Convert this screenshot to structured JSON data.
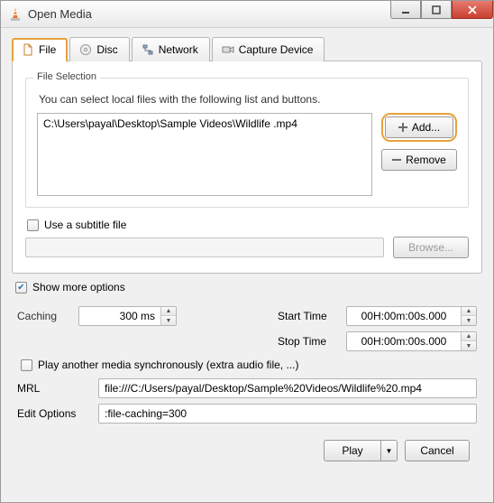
{
  "window": {
    "title": "Open Media"
  },
  "tabs": {
    "file": "File",
    "disc": "Disc",
    "network": "Network",
    "capture": "Capture Device"
  },
  "file_selection": {
    "group_title": "File Selection",
    "help": "You can select local files with the following list and buttons.",
    "files": [
      "C:\\Users\\payal\\Desktop\\Sample Videos\\Wildlife .mp4"
    ],
    "add_label": "Add...",
    "remove_label": "Remove"
  },
  "subtitle": {
    "checkbox_label": "Use a subtitle file",
    "browse_label": "Browse..."
  },
  "show_more": {
    "label": "Show more options",
    "checked": true
  },
  "options": {
    "caching_label": "Caching",
    "caching_value": "300 ms",
    "start_label": "Start Time",
    "start_value": "00H:00m:00s.000",
    "stop_label": "Stop Time",
    "stop_value": "00H:00m:00s.000",
    "synch_label": "Play another media synchronously (extra audio file, ...)",
    "mrl_label": "MRL",
    "mrl_value": "file:///C:/Users/payal/Desktop/Sample%20Videos/Wildlife%20.mp4",
    "edit_label": "Edit Options",
    "edit_value": ":file-caching=300"
  },
  "footer": {
    "play": "Play",
    "cancel": "Cancel"
  }
}
